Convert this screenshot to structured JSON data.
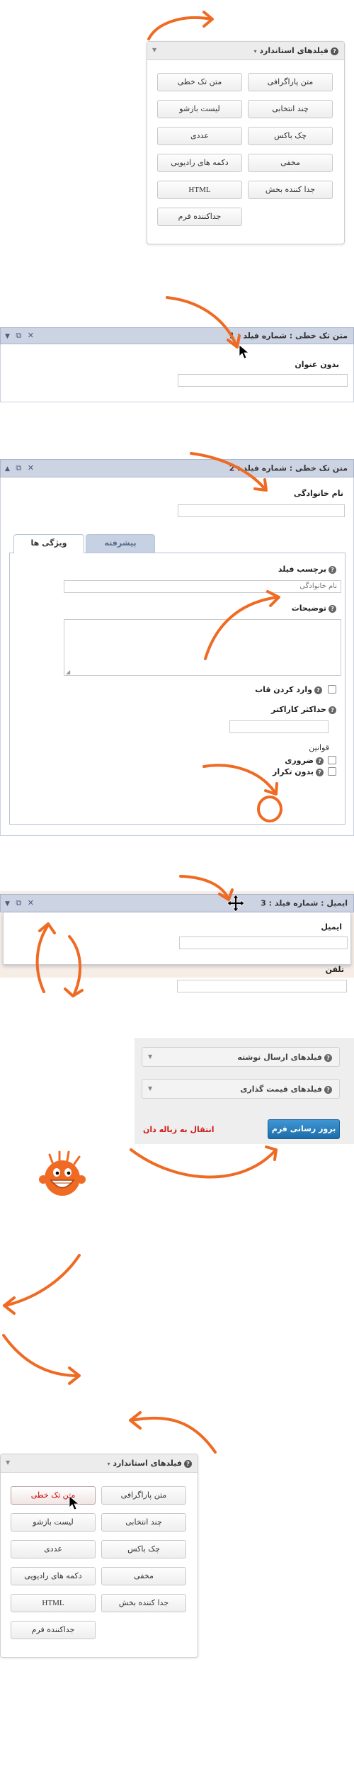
{
  "standard_fields": {
    "title": "فیلدهای استاندارد",
    "buttons": [
      "متن پاراگرافی",
      "متن تک خطی",
      "چند انتخابی",
      "لیست بازشو",
      "چک باکس",
      "عددی",
      "مخفی",
      "دکمه های رادیویی",
      "جدا کننده بخش",
      "HTML",
      "جداکننده فرم"
    ]
  },
  "field1": {
    "title": "متن تک خطی : شماره فیلد : 1",
    "label": "بدون عنوان"
  },
  "field2": {
    "title": "متن تک خطی : شماره فیلد : 2",
    "label": "نام خانوادگی",
    "tabs": [
      "ویژگی ها",
      "پیشرفته"
    ],
    "field_label_title": "برچسب فیلد",
    "field_label_value": "نام خانوادگی",
    "description_title": "توضیحات",
    "framed_input": "وارد کردن قاب",
    "max_chars": "حداکثر کاراکتر",
    "rules_title": "قوانین",
    "required": "ضروری",
    "no_repeat": "بدون تکرار"
  },
  "field3": {
    "title": "ایمیل : شماره فیلد : 3",
    "label": "ایمیل",
    "next_label": "تلفن"
  },
  "post_settings": {
    "panels": [
      "فیلدهای ارسال نوشته",
      "فیلدهای قیمت گذاری"
    ],
    "update_button": "بروز رسانی فرم",
    "trash_link": "انتقال به زباله دان"
  },
  "colors": {
    "accent_orange": "#ef6a22",
    "header_blue": "#ccd4e4",
    "update_blue": "#2a7fc1",
    "trash_red": "#d21b1b"
  },
  "icons": {
    "duplicate": "duplicate-icon",
    "delete": "delete-icon",
    "move": "move-cursor-icon",
    "mascot": "smiley-mascot-icon",
    "pointer": "mouse-pointer-icon"
  }
}
